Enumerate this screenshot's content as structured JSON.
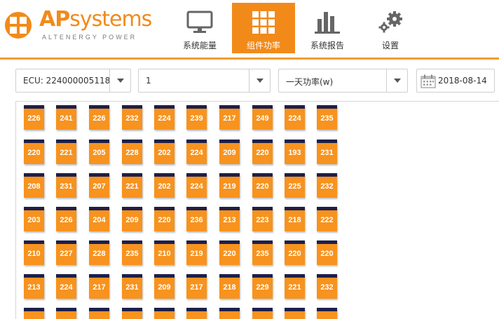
{
  "brand": {
    "name_ap": "AP",
    "name_rest": "systems",
    "tagline": "ALTENERGY POWER"
  },
  "nav": [
    {
      "label": "系统能量",
      "icon": "monitor-icon",
      "active": false
    },
    {
      "label": "组件功率",
      "icon": "grid-icon",
      "active": true
    },
    {
      "label": "系统报告",
      "icon": "bar-chart-icon",
      "active": false
    },
    {
      "label": "设置",
      "icon": "gear-icon",
      "active": false
    }
  ],
  "toolbar": {
    "ecu_select": "ECU: 224000005118",
    "page_select": "1",
    "mode_select": "一天功率(w)",
    "date": "2018-08-14"
  },
  "colors": {
    "accent": "#f28a1a",
    "panel": "#f7931e",
    "panel_cap": "#1d1f4a"
  },
  "panels": [
    [
      "226",
      "241",
      "226",
      "232",
      "224",
      "239",
      "217",
      "249",
      "224",
      "235"
    ],
    [
      "220",
      "221",
      "205",
      "228",
      "202",
      "224",
      "209",
      "220",
      "193",
      "231"
    ],
    [
      "208",
      "231",
      "207",
      "221",
      "202",
      "224",
      "219",
      "220",
      "225",
      "232"
    ],
    [
      "203",
      "226",
      "204",
      "209",
      "220",
      "236",
      "213",
      "223",
      "218",
      "222"
    ],
    [
      "210",
      "227",
      "228",
      "235",
      "210",
      "219",
      "220",
      "235",
      "220",
      "220"
    ],
    [
      "213",
      "224",
      "217",
      "231",
      "209",
      "217",
      "218",
      "229",
      "221",
      "232"
    ],
    [
      "",
      "",
      "",
      "",
      "",
      "",
      "",
      "",
      "",
      ""
    ]
  ]
}
